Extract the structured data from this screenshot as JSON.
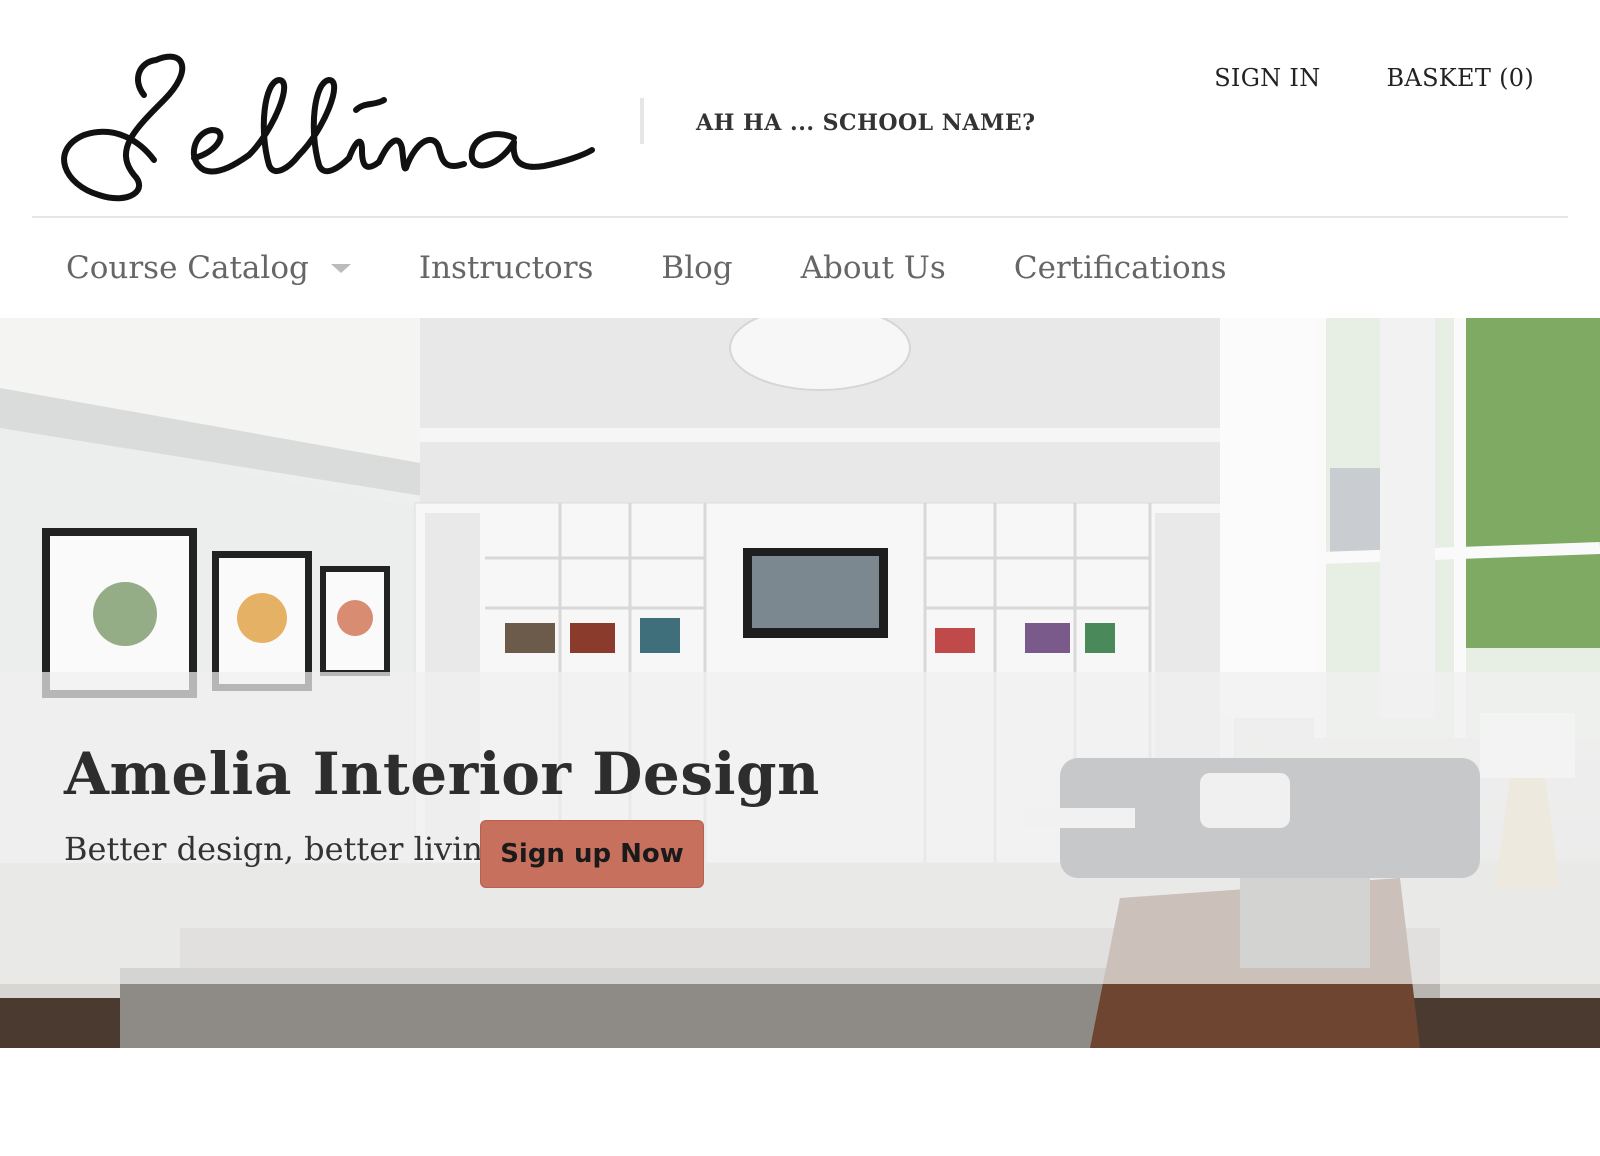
{
  "header": {
    "logo_text": "Sellina",
    "tagline": "AH HA ... SCHOOL NAME?",
    "sign_in": "SIGN IN",
    "basket": "BASKET (0)"
  },
  "nav": {
    "items": [
      {
        "label": "Course Catalog",
        "has_dropdown": true
      },
      {
        "label": "Instructors"
      },
      {
        "label": "Blog"
      },
      {
        "label": "About Us"
      },
      {
        "label": "Certifications"
      }
    ]
  },
  "hero": {
    "title": "Amelia Interior Design",
    "subtitle": "Better design, better living",
    "cta_label": "Sign up Now"
  },
  "colors": {
    "cta": "#c8705e",
    "nav_text": "#666666",
    "text": "#333333"
  }
}
